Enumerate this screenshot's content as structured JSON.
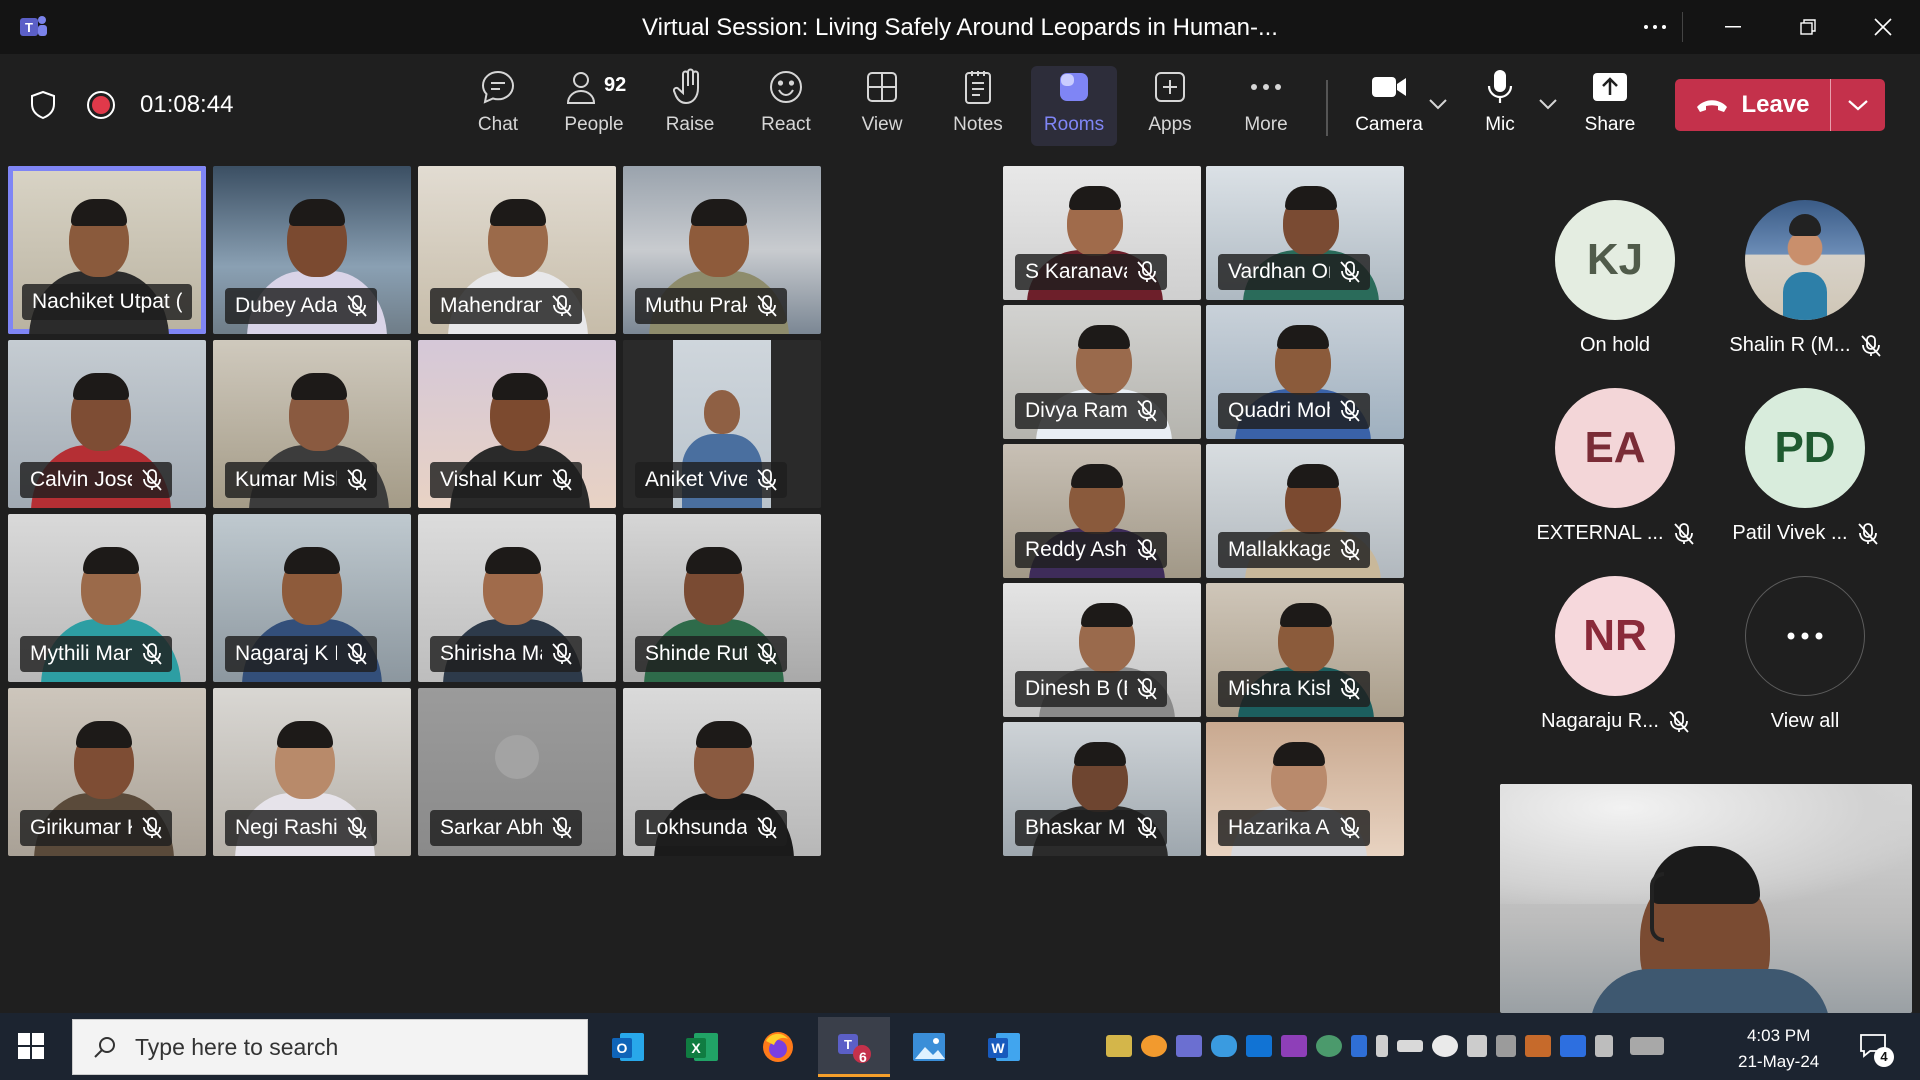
{
  "window": {
    "title": "Virtual Session: Living Safely Around Leopards in Human-..."
  },
  "toolbar": {
    "timer": "01:08:44",
    "people_count": "92",
    "buttons": {
      "chat": "Chat",
      "people": "People",
      "raise": "Raise",
      "react": "React",
      "view": "View",
      "notes": "Notes",
      "rooms": "Rooms",
      "apps": "Apps",
      "more": "More",
      "camera": "Camera",
      "mic": "Mic",
      "share": "Share"
    },
    "leave": "Leave"
  },
  "tiles": [
    {
      "name": "Nachiket Utpat (U...",
      "speaking": true
    },
    {
      "name": "Dubey Adars..."
    },
    {
      "name": "Mahendran K..."
    },
    {
      "name": "Muthu Prakas..."
    },
    {
      "name": "S Karanavar S..."
    },
    {
      "name": "Vardhan Orav..."
    },
    {
      "name": "Divya Raman..."
    },
    {
      "name": "Quadri Mohd..."
    },
    {
      "name": "Calvin Jose Ri..."
    },
    {
      "name": "Kumar Mishra..."
    },
    {
      "name": "Vishal Kumar ..."
    },
    {
      "name": "Aniket Viveka..."
    },
    {
      "name": "Reddy Ashwi..."
    },
    {
      "name": "Mallakkagari ..."
    },
    {
      "name": "Mythili Mano..."
    },
    {
      "name": "Nagaraj K R (..."
    },
    {
      "name": "Shirisha Mark..."
    },
    {
      "name": "Shinde Rutuja..."
    },
    {
      "name": "Dinesh B (BG..."
    },
    {
      "name": "Mishra Kishan..."
    },
    {
      "name": "Girikumar Ku..."
    },
    {
      "name": "Negi Rashi (B..."
    },
    {
      "name": "Sarkar Abhijit ..."
    },
    {
      "name": "Lokhsundar B..."
    },
    {
      "name": "Bhaskar M L (..."
    },
    {
      "name": "Hazarika Arpi..."
    }
  ],
  "roster": [
    {
      "initials": "KJ",
      "label": "On hold",
      "bg": "#e4ede1",
      "fg": "#505b4a"
    },
    {
      "initials": "",
      "label": "Shalin R (M...",
      "photo": true
    },
    {
      "initials": "EA",
      "label": "EXTERNAL ...",
      "bg": "#f3d6d8",
      "fg": "#7a2c36"
    },
    {
      "initials": "PD",
      "label": "Patil Vivek ...",
      "bg": "#d8ecdc",
      "fg": "#1f5a30"
    },
    {
      "initials": "NR",
      "label": "Nagaraju R...",
      "bg": "#f6d8dc",
      "fg": "#8a2a3a"
    },
    {
      "initials": "",
      "label": "View all",
      "more": true
    }
  ],
  "taskbar": {
    "search_placeholder": "Type here to search",
    "teams_badge": "6",
    "time": "4:03 PM",
    "date": "21-May-24",
    "notifications": "4"
  },
  "colors": {
    "accent": "#7f85f5",
    "leave": "#c4314b",
    "background": "#1f1f1f"
  }
}
